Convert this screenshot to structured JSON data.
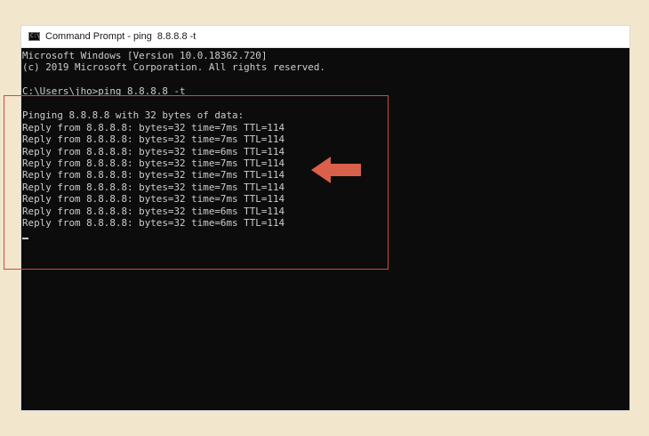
{
  "window": {
    "title": "Command Prompt - ping  8.8.8.8 -t",
    "icon": "console-app-icon",
    "icon_glyph": "C:\\"
  },
  "console": {
    "lines": [
      "Microsoft Windows [Version 10.0.18362.720]",
      "(c) 2019 Microsoft Corporation. All rights reserved.",
      "",
      "C:\\Users\\jho>ping 8.8.8.8 -t",
      "",
      "Pinging 8.8.8.8 with 32 bytes of data:",
      "Reply from 8.8.8.8: bytes=32 time=7ms TTL=114",
      "Reply from 8.8.8.8: bytes=32 time=7ms TTL=114",
      "Reply from 8.8.8.8: bytes=32 time=6ms TTL=114",
      "Reply from 8.8.8.8: bytes=32 time=7ms TTL=114",
      "Reply from 8.8.8.8: bytes=32 time=7ms TTL=114",
      "Reply from 8.8.8.8: bytes=32 time=7ms TTL=114",
      "Reply from 8.8.8.8: bytes=32 time=7ms TTL=114",
      "Reply from 8.8.8.8: bytes=32 time=6ms TTL=114",
      "Reply from 8.8.8.8: bytes=32 time=6ms TTL=114"
    ]
  },
  "annotation": {
    "box_color": "#d24a3c",
    "arrow_color": "#d9604a",
    "arrow_icon": "left-arrow-icon"
  },
  "colors": {
    "background": "#f2e6cd",
    "console_bg": "#0c0c0c",
    "console_text": "#cccccc"
  }
}
